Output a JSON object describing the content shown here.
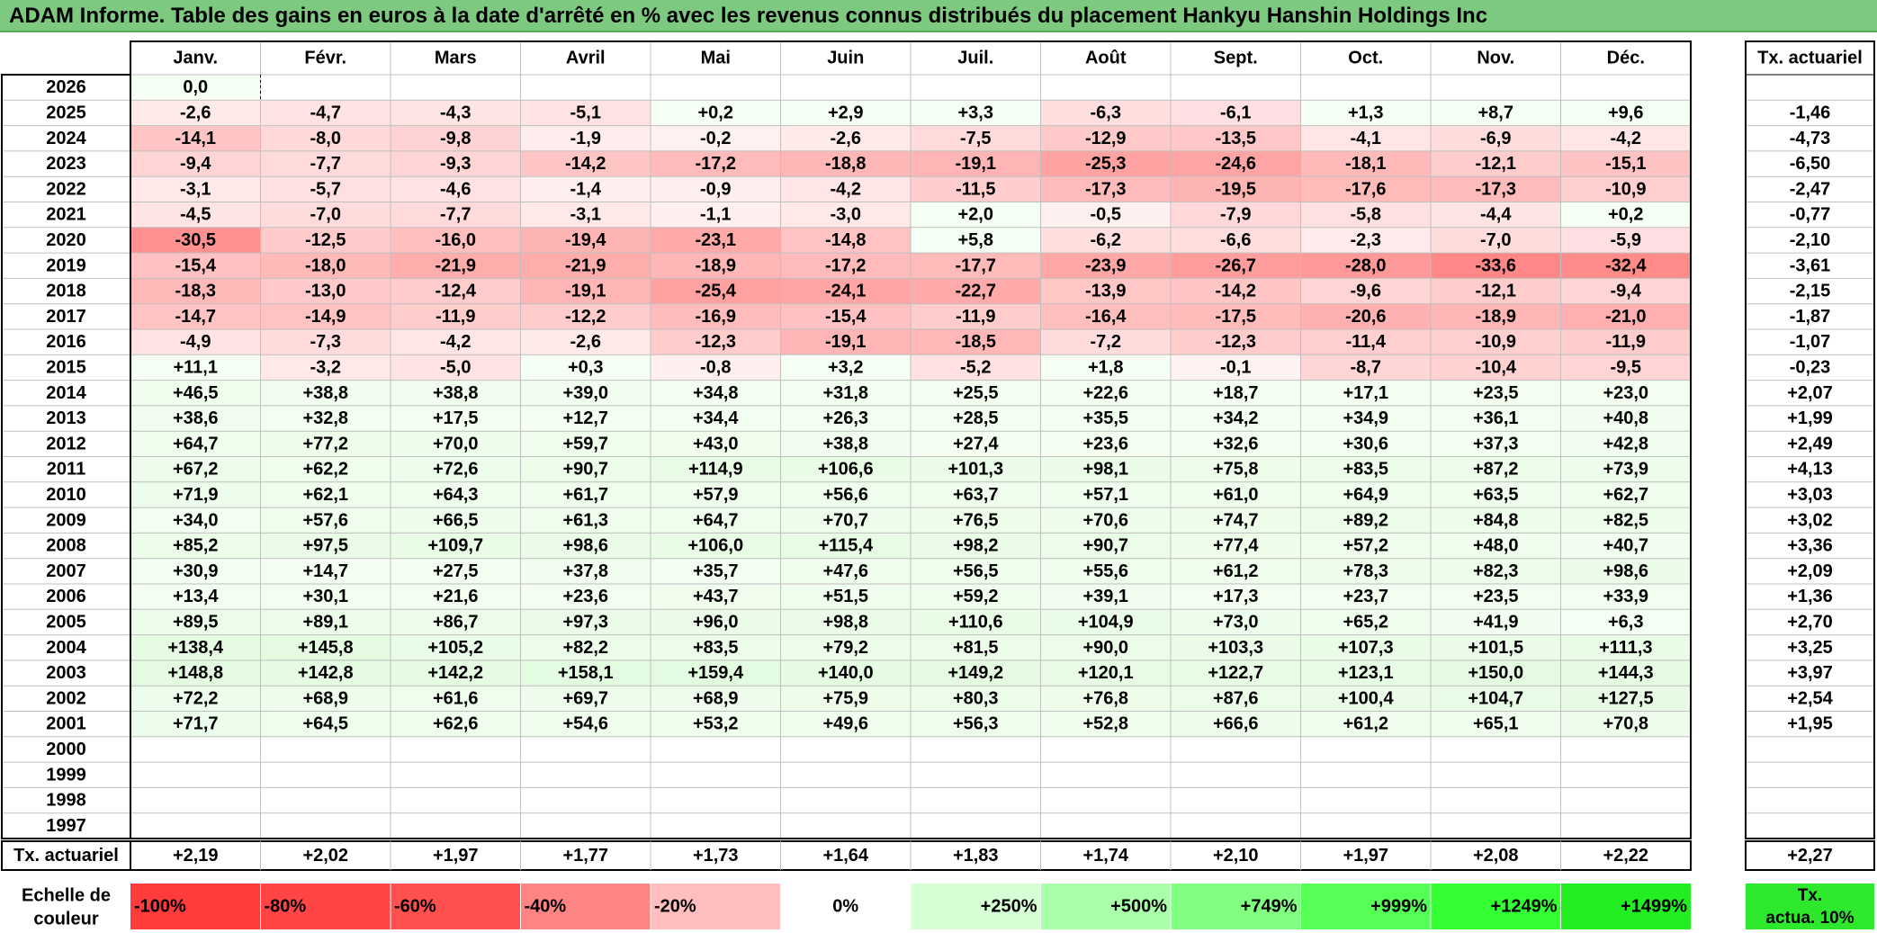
{
  "title": "ADAM Informe. Table des gains en euros à la date d'arrêté en % avec les revenus connus distribués du placement Hankyu Hanshin Holdings Inc",
  "chart_data": {
    "type": "table",
    "months": [
      "Janv.",
      "Févr.",
      "Mars",
      "Avril",
      "Mai",
      "Juin",
      "Juil.",
      "Août",
      "Sept.",
      "Oct.",
      "Nov.",
      "Déc."
    ],
    "annual_header": "Tx. actuariel",
    "rows": [
      {
        "year": "2026",
        "values": [
          "0,0",
          "",
          "",
          "",
          "",
          "",
          "",
          "",
          "",
          "",
          "",
          ""
        ],
        "annual": ""
      },
      {
        "year": "2025",
        "values": [
          "-2,6",
          "-4,7",
          "-4,3",
          "-5,1",
          "+0,2",
          "+2,9",
          "+3,3",
          "-6,3",
          "-6,1",
          "+1,3",
          "+8,7",
          "+9,6"
        ],
        "annual": "-1,46"
      },
      {
        "year": "2024",
        "values": [
          "-14,1",
          "-8,0",
          "-9,8",
          "-1,9",
          "-0,2",
          "-2,6",
          "-7,5",
          "-12,9",
          "-13,5",
          "-4,1",
          "-6,9",
          "-4,2"
        ],
        "annual": "-4,73"
      },
      {
        "year": "2023",
        "values": [
          "-9,4",
          "-7,7",
          "-9,3",
          "-14,2",
          "-17,2",
          "-18,8",
          "-19,1",
          "-25,3",
          "-24,6",
          "-18,1",
          "-12,1",
          "-15,1"
        ],
        "annual": "-6,50"
      },
      {
        "year": "2022",
        "values": [
          "-3,1",
          "-5,7",
          "-4,6",
          "-1,4",
          "-0,9",
          "-4,2",
          "-11,5",
          "-17,3",
          "-19,5",
          "-17,6",
          "-17,3",
          "-10,9"
        ],
        "annual": "-2,47"
      },
      {
        "year": "2021",
        "values": [
          "-4,5",
          "-7,0",
          "-7,7",
          "-3,1",
          "-1,1",
          "-3,0",
          "+2,0",
          "-0,5",
          "-7,9",
          "-5,8",
          "-4,4",
          "+0,2"
        ],
        "annual": "-0,77"
      },
      {
        "year": "2020",
        "values": [
          "-30,5",
          "-12,5",
          "-16,0",
          "-19,4",
          "-23,1",
          "-14,8",
          "+5,8",
          "-6,2",
          "-6,6",
          "-2,3",
          "-7,0",
          "-5,9"
        ],
        "annual": "-2,10"
      },
      {
        "year": "2019",
        "values": [
          "-15,4",
          "-18,0",
          "-21,9",
          "-21,9",
          "-18,9",
          "-17,2",
          "-17,7",
          "-23,9",
          "-26,7",
          "-28,0",
          "-33,6",
          "-32,4"
        ],
        "annual": "-3,61"
      },
      {
        "year": "2018",
        "values": [
          "-18,3",
          "-13,0",
          "-12,4",
          "-19,1",
          "-25,4",
          "-24,1",
          "-22,7",
          "-13,9",
          "-14,2",
          "-9,6",
          "-12,1",
          "-9,4"
        ],
        "annual": "-2,15"
      },
      {
        "year": "2017",
        "values": [
          "-14,7",
          "-14,9",
          "-11,9",
          "-12,2",
          "-16,9",
          "-15,4",
          "-11,9",
          "-16,4",
          "-17,5",
          "-20,6",
          "-18,9",
          "-21,0"
        ],
        "annual": "-1,87"
      },
      {
        "year": "2016",
        "values": [
          "-4,9",
          "-7,3",
          "-4,2",
          "-2,6",
          "-12,3",
          "-19,1",
          "-18,5",
          "-7,2",
          "-12,3",
          "-11,4",
          "-10,9",
          "-11,9"
        ],
        "annual": "-1,07"
      },
      {
        "year": "2015",
        "values": [
          "+11,1",
          "-3,2",
          "-5,0",
          "+0,3",
          "-0,8",
          "+3,2",
          "-5,2",
          "+1,8",
          "-0,1",
          "-8,7",
          "-10,4",
          "-9,5"
        ],
        "annual": "-0,23"
      },
      {
        "year": "2014",
        "values": [
          "+46,5",
          "+38,8",
          "+38,8",
          "+39,0",
          "+34,8",
          "+31,8",
          "+25,5",
          "+22,6",
          "+18,7",
          "+17,1",
          "+23,5",
          "+23,0"
        ],
        "annual": "+2,07"
      },
      {
        "year": "2013",
        "values": [
          "+38,6",
          "+32,8",
          "+17,5",
          "+12,7",
          "+34,4",
          "+26,3",
          "+28,5",
          "+35,5",
          "+34,2",
          "+34,9",
          "+36,1",
          "+40,8"
        ],
        "annual": "+1,99"
      },
      {
        "year": "2012",
        "values": [
          "+64,7",
          "+77,2",
          "+70,0",
          "+59,7",
          "+43,0",
          "+38,8",
          "+27,4",
          "+23,6",
          "+32,6",
          "+30,6",
          "+37,3",
          "+42,8"
        ],
        "annual": "+2,49"
      },
      {
        "year": "2011",
        "values": [
          "+67,2",
          "+62,2",
          "+72,6",
          "+90,7",
          "+114,9",
          "+106,6",
          "+101,3",
          "+98,1",
          "+75,8",
          "+83,5",
          "+87,2",
          "+73,9"
        ],
        "annual": "+4,13"
      },
      {
        "year": "2010",
        "values": [
          "+71,9",
          "+62,1",
          "+64,3",
          "+61,7",
          "+57,9",
          "+56,6",
          "+63,7",
          "+57,1",
          "+61,0",
          "+64,9",
          "+63,5",
          "+62,7"
        ],
        "annual": "+3,03"
      },
      {
        "year": "2009",
        "values": [
          "+34,0",
          "+57,6",
          "+66,5",
          "+61,3",
          "+64,7",
          "+70,7",
          "+76,5",
          "+70,6",
          "+74,7",
          "+89,2",
          "+84,8",
          "+82,5"
        ],
        "annual": "+3,02"
      },
      {
        "year": "2008",
        "values": [
          "+85,2",
          "+97,5",
          "+109,7",
          "+98,6",
          "+106,0",
          "+115,4",
          "+98,2",
          "+90,7",
          "+77,4",
          "+57,2",
          "+48,0",
          "+40,7"
        ],
        "annual": "+3,36"
      },
      {
        "year": "2007",
        "values": [
          "+30,9",
          "+14,7",
          "+27,5",
          "+37,8",
          "+35,7",
          "+47,6",
          "+56,5",
          "+55,6",
          "+61,2",
          "+78,3",
          "+82,3",
          "+98,6"
        ],
        "annual": "+2,09"
      },
      {
        "year": "2006",
        "values": [
          "+13,4",
          "+30,1",
          "+21,6",
          "+23,6",
          "+43,7",
          "+51,5",
          "+59,2",
          "+39,1",
          "+17,3",
          "+23,7",
          "+23,5",
          "+33,9"
        ],
        "annual": "+1,36"
      },
      {
        "year": "2005",
        "values": [
          "+89,5",
          "+89,1",
          "+86,7",
          "+97,3",
          "+96,0",
          "+98,8",
          "+110,6",
          "+104,9",
          "+73,0",
          "+65,2",
          "+41,9",
          "+6,3"
        ],
        "annual": "+2,70"
      },
      {
        "year": "2004",
        "values": [
          "+138,4",
          "+145,8",
          "+105,2",
          "+82,2",
          "+83,5",
          "+79,2",
          "+81,5",
          "+90,0",
          "+103,3",
          "+107,3",
          "+101,5",
          "+111,3"
        ],
        "annual": "+3,25"
      },
      {
        "year": "2003",
        "values": [
          "+148,8",
          "+142,8",
          "+142,2",
          "+158,1",
          "+159,4",
          "+140,0",
          "+149,2",
          "+120,1",
          "+122,7",
          "+123,1",
          "+150,0",
          "+144,3"
        ],
        "annual": "+3,97"
      },
      {
        "year": "2002",
        "values": [
          "+72,2",
          "+68,9",
          "+61,6",
          "+69,7",
          "+68,9",
          "+75,9",
          "+80,3",
          "+76,8",
          "+87,6",
          "+100,4",
          "+104,7",
          "+127,5"
        ],
        "annual": "+2,54"
      },
      {
        "year": "2001",
        "values": [
          "+71,7",
          "+64,5",
          "+62,6",
          "+54,6",
          "+53,2",
          "+49,6",
          "+56,3",
          "+52,8",
          "+66,6",
          "+61,2",
          "+65,1",
          "+70,8"
        ],
        "annual": "+1,95"
      },
      {
        "year": "2000",
        "values": [
          "",
          "",
          "",
          "",
          "",
          "",
          "",
          "",
          "",
          "",
          "",
          ""
        ],
        "annual": ""
      },
      {
        "year": "1999",
        "values": [
          "",
          "",
          "",
          "",
          "",
          "",
          "",
          "",
          "",
          "",
          "",
          ""
        ],
        "annual": ""
      },
      {
        "year": "1998",
        "values": [
          "",
          "",
          "",
          "",
          "",
          "",
          "",
          "",
          "",
          "",
          "",
          ""
        ],
        "annual": ""
      },
      {
        "year": "1997",
        "values": [
          "",
          "",
          "",
          "",
          "",
          "",
          "",
          "",
          "",
          "",
          "",
          ""
        ],
        "annual": ""
      }
    ],
    "footer": {
      "label": "Tx. actuariel",
      "values": [
        "+2,19",
        "+2,02",
        "+1,97",
        "+1,77",
        "+1,73",
        "+1,64",
        "+1,83",
        "+1,74",
        "+2,10",
        "+1,97",
        "+2,08",
        "+2,22"
      ],
      "annual": "+2,27"
    },
    "scale": {
      "label_line1": "Echelle de",
      "label_line2": "couleur",
      "items": [
        {
          "label": "-100%",
          "color": "#ff3b3b"
        },
        {
          "label": "-80%",
          "color": "#ff4545"
        },
        {
          "label": "-60%",
          "color": "#ff5050"
        },
        {
          "label": "-40%",
          "color": "#ff8484"
        },
        {
          "label": "-20%",
          "color": "#ffbfbf"
        },
        {
          "label": "0%",
          "color": "#ffffff"
        },
        {
          "label": "+250%",
          "color": "#d6ffd6"
        },
        {
          "label": "+500%",
          "color": "#aaffaa"
        },
        {
          "label": "+749%",
          "color": "#80ff80"
        },
        {
          "label": "+999%",
          "color": "#55ff55"
        },
        {
          "label": "+1249%",
          "color": "#33ff33"
        },
        {
          "label": "+1499%",
          "color": "#22ee22"
        }
      ],
      "annual_line1": "Tx.",
      "annual_line2": "actua. 10%",
      "annual_color": "#2ee82e"
    }
  }
}
